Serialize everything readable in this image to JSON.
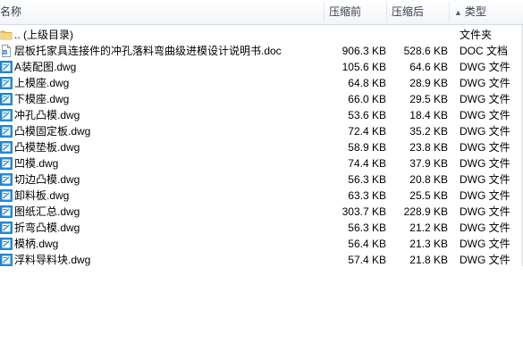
{
  "header": {
    "name": "名称",
    "original_size": "压缩前",
    "compressed_size": "压缩后",
    "type": "类型",
    "sort_arrow": "▲"
  },
  "files": [
    {
      "name": ".. (上级目录)",
      "original": "",
      "compressed": "",
      "type": "文件夹",
      "icon": "folder-icon"
    },
    {
      "name": "层板托家具连接件的冲孔落料弯曲级进模设计说明书.doc",
      "original": "906.3 KB",
      "compressed": "528.6 KB",
      "type": "DOC 文档",
      "icon": "doc-file-icon"
    },
    {
      "name": "A装配图.dwg",
      "original": "105.6 KB",
      "compressed": "64.6 KB",
      "type": "DWG 文件",
      "icon": "dwg-file-icon"
    },
    {
      "name": "上模座.dwg",
      "original": "64.8 KB",
      "compressed": "28.9 KB",
      "type": "DWG 文件",
      "icon": "dwg-file-icon"
    },
    {
      "name": "下模座.dwg",
      "original": "66.0 KB",
      "compressed": "29.5 KB",
      "type": "DWG 文件",
      "icon": "dwg-file-icon"
    },
    {
      "name": "冲孔凸模.dwg",
      "original": "53.6 KB",
      "compressed": "18.4 KB",
      "type": "DWG 文件",
      "icon": "dwg-file-icon"
    },
    {
      "name": "凸模固定板.dwg",
      "original": "72.4 KB",
      "compressed": "35.2 KB",
      "type": "DWG 文件",
      "icon": "dwg-file-icon"
    },
    {
      "name": "凸模垫板.dwg",
      "original": "58.9 KB",
      "compressed": "23.8 KB",
      "type": "DWG 文件",
      "icon": "dwg-file-icon"
    },
    {
      "name": "凹模.dwg",
      "original": "74.4 KB",
      "compressed": "37.9 KB",
      "type": "DWG 文件",
      "icon": "dwg-file-icon"
    },
    {
      "name": "切边凸模.dwg",
      "original": "56.3 KB",
      "compressed": "20.8 KB",
      "type": "DWG 文件",
      "icon": "dwg-file-icon"
    },
    {
      "name": "卸料板.dwg",
      "original": "63.3 KB",
      "compressed": "25.5 KB",
      "type": "DWG 文件",
      "icon": "dwg-file-icon"
    },
    {
      "name": "图纸汇总.dwg",
      "original": "303.7 KB",
      "compressed": "228.9 KB",
      "type": "DWG 文件",
      "icon": "dwg-file-icon"
    },
    {
      "name": "折弯凸模.dwg",
      "original": "56.3 KB",
      "compressed": "21.2 KB",
      "type": "DWG 文件",
      "icon": "dwg-file-icon"
    },
    {
      "name": "模柄.dwg",
      "original": "56.4 KB",
      "compressed": "21.3 KB",
      "type": "DWG 文件",
      "icon": "dwg-file-icon"
    },
    {
      "name": "浮料导料块.dwg",
      "original": "57.4 KB",
      "compressed": "21.8 KB",
      "type": "DWG 文件",
      "icon": "dwg-file-icon"
    }
  ]
}
